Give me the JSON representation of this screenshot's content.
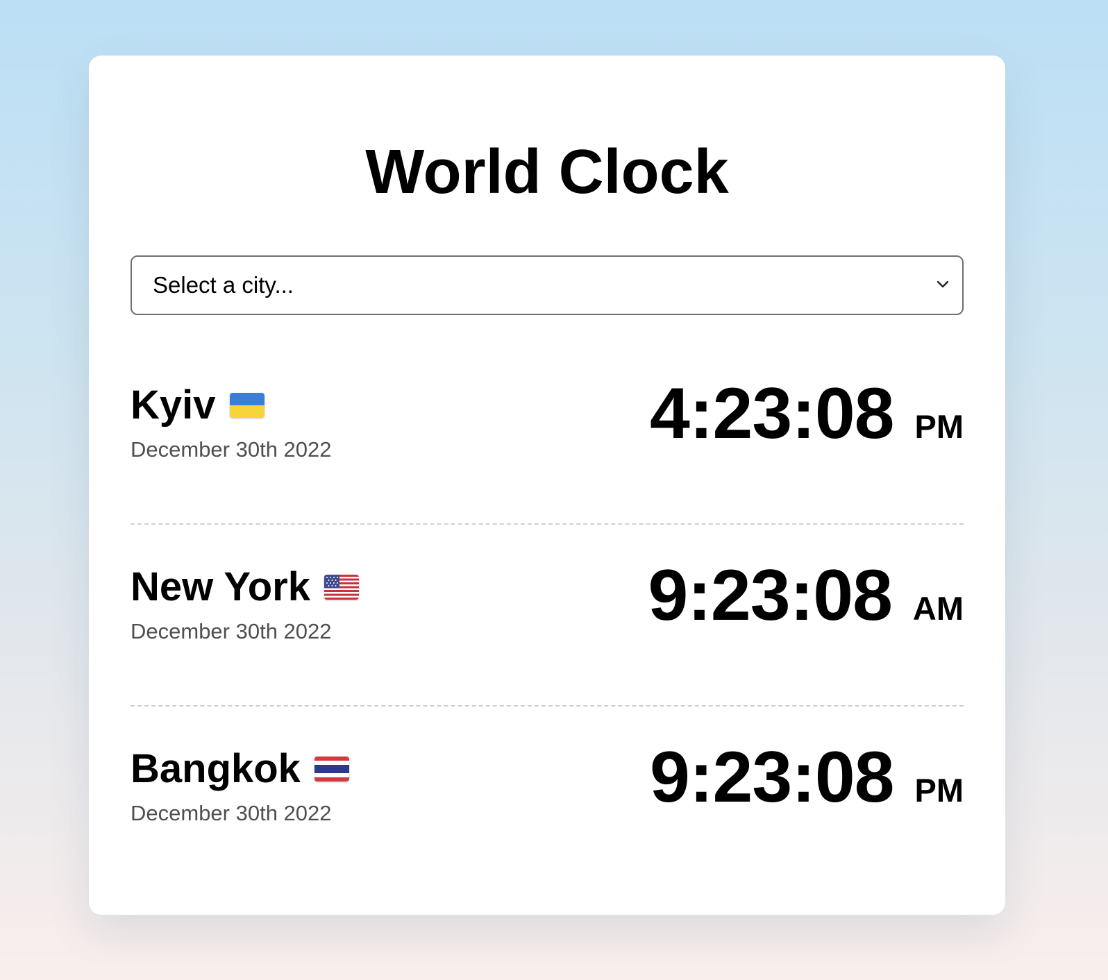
{
  "app": {
    "title": "World Clock"
  },
  "city_select": {
    "selected_label": "Select a city...",
    "icon": "chevron-down-icon"
  },
  "cities": [
    {
      "name": "Kyiv",
      "flag": "flag-ukraine-icon",
      "date": "December 30th 2022",
      "time": "4:23:08",
      "ampm": "PM"
    },
    {
      "name": "New York",
      "flag": "flag-usa-icon",
      "date": "December 30th 2022",
      "time": "9:23:08",
      "ampm": "AM"
    },
    {
      "name": "Bangkok",
      "flag": "flag-thailand-icon",
      "date": "December 30th 2022",
      "time": "9:23:08",
      "ampm": "PM"
    }
  ],
  "colors": {
    "background_top": "#bcdff5",
    "background_bottom": "#f9eeec",
    "card": "#ffffff",
    "date_text": "#4f4f4f",
    "divider": "#cfcfcf"
  }
}
